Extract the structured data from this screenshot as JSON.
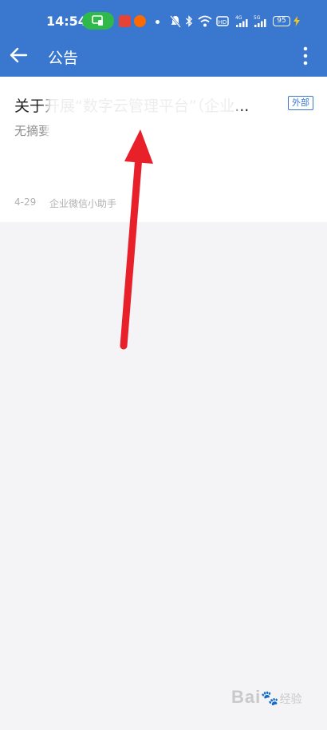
{
  "status_bar": {
    "time": "14:54",
    "battery": "95",
    "network_labels": [
      "HD",
      "4G",
      "5G"
    ]
  },
  "header": {
    "title": "公告",
    "back_icon": "arrow-left-icon",
    "more_icon": "more-vertical-icon"
  },
  "announcement": {
    "title": "关于开展“数字云管理平台”（企业...",
    "tag": "外部",
    "summary": "无摘要",
    "date": "4-29",
    "sender": "企业微信小助手"
  },
  "watermark": {
    "brand": "Bai",
    "suffix": "经验"
  },
  "colors": {
    "header_bg": "#3a78d0",
    "page_bg": "#f4f4f6",
    "tag": "#3a78d0",
    "annotation_arrow": "#e8202a",
    "cast_pill": "#2fb94a"
  }
}
